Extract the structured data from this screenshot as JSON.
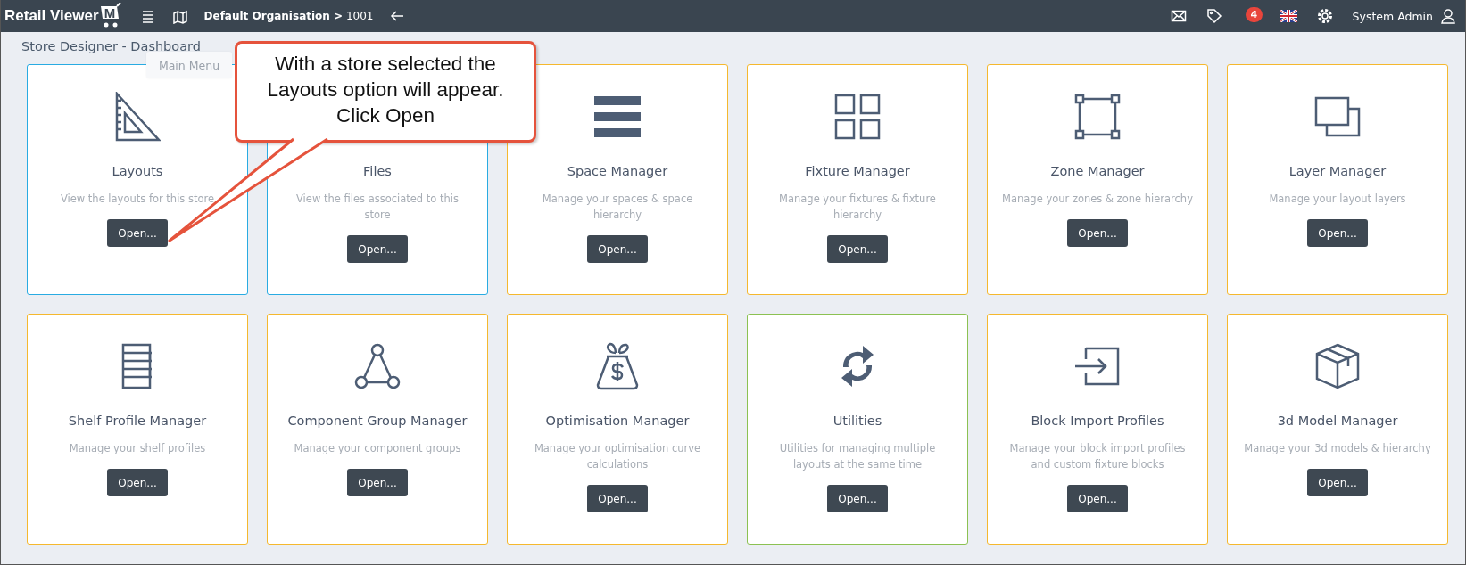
{
  "top_bar": {
    "logo": {
      "text": "Retail Viewer",
      "mark": "M"
    },
    "breadcrumb": "**Default Organisation >** 1001",
    "notification_count": "4",
    "user": "System Admin"
  },
  "page_title": "Store Designer - Dashboard",
  "tooltip": "Main Menu",
  "callout": "With a store selected the Layouts option will appear. Click Open",
  "cards": [
    {
      "title": "Layouts",
      "description": "View the layouts for this store",
      "button": "Open...",
      "color": "#29abe2"
    },
    {
      "title": "Files",
      "description": "View the files associated to this store",
      "button": "Open...",
      "color": "#29abe2"
    },
    {
      "title": "Space Manager",
      "description": "Manage your spaces & space hierarchy",
      "button": "Open...",
      "color": "#f5b82e"
    },
    {
      "title": "Fixture Manager",
      "description": "Manage your fixtures & fixture hierarchy",
      "button": "Open...",
      "color": "#f5b82e"
    },
    {
      "title": "Zone Manager",
      "description": "Manage your zones & zone hierarchy",
      "button": "Open...",
      "color": "#f5b82e"
    },
    {
      "title": "Layer Manager",
      "description": "Manage your layout layers",
      "button": "Open...",
      "color": "#f5b82e"
    },
    {
      "title": "Shelf Profile Manager",
      "description": "Manage your shelf profiles",
      "button": "Open...",
      "color": "#f5b82e"
    },
    {
      "title": "Component Group Manager",
      "description": "Manage your component groups",
      "button": "Open...",
      "color": "#f5b82e"
    },
    {
      "title": "Optimisation Manager",
      "description": "Manage your optimisation curve calculations",
      "button": "Open...",
      "color": "#f5b82e"
    },
    {
      "title": "Utilities",
      "description": "Utilities for managing multiple layouts at the same time",
      "button": "Open...",
      "color": "#8cc152"
    },
    {
      "title": "Block Import Profiles",
      "description": "Manage your block import profiles and custom fixture blocks",
      "button": "Open...",
      "color": "#f5b82e"
    },
    {
      "title": "3d Model Manager",
      "description": "Manage your 3d models & hierarchy",
      "button": "Open...",
      "color": "#f5b82e"
    }
  ]
}
